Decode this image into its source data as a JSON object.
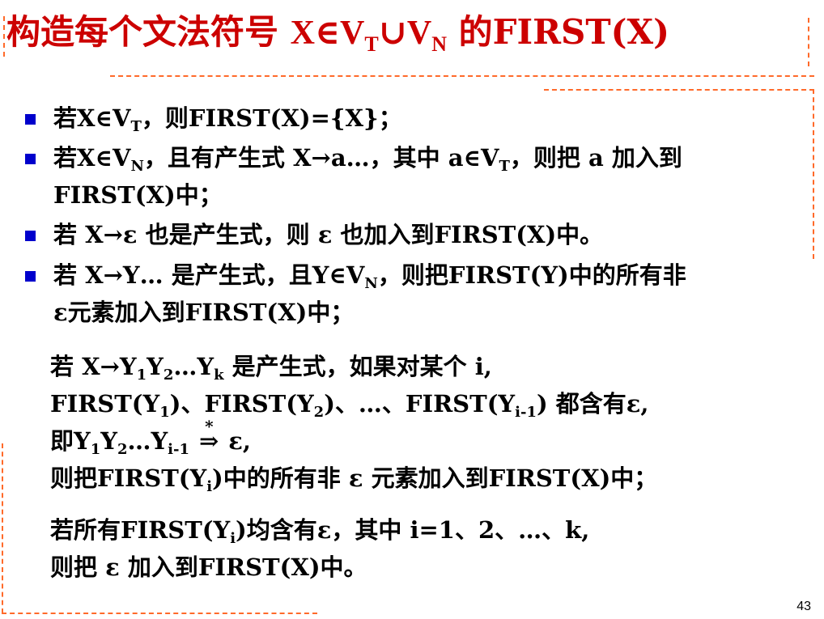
{
  "title": {
    "prefix": "构造每个文法符号 ",
    "formula_a": "X∈V",
    "sub_a": "T",
    "union": "∪V",
    "sub_b": "N",
    "suffix": " 的FIRST(X)"
  },
  "bullets": [
    {
      "lines": [
        [
          {
            "t": "若X∈V"
          },
          {
            "sub": "T"
          },
          {
            "t": "，则FIRST(X)={X}；"
          }
        ]
      ]
    },
    {
      "lines": [
        [
          {
            "t": "若X∈V"
          },
          {
            "sub": "N"
          },
          {
            "t": "，且有产生式 X→a…，其中 a∈V"
          },
          {
            "sub": "T"
          },
          {
            "t": "，则把 a 加入到"
          }
        ],
        [
          {
            "t": "FIRST(X)中；"
          }
        ]
      ]
    },
    {
      "lines": [
        [
          {
            "t": "若 X→ε 也是产生式，则 ε 也加入到FIRST(X)中。"
          }
        ]
      ]
    },
    {
      "lines": [
        [
          {
            "t": "若 X→Y… 是产生式，且Y∈V"
          },
          {
            "sub": "N"
          },
          {
            "t": "，则把FIRST(Y)中的所有非"
          }
        ],
        [
          {
            "t": "ε元素加入到FIRST(X)中；"
          }
        ]
      ]
    }
  ],
  "block1": {
    "row1": [
      {
        "t": "若 X→Y"
      },
      {
        "sub": "1"
      },
      {
        "t": "Y"
      },
      {
        "sub": "2"
      },
      {
        "t": "…Y"
      },
      {
        "sub": "k"
      },
      {
        "t": " 是产生式，如果对某个 i,"
      }
    ],
    "row2": [
      {
        "t": "FIRST(Y"
      },
      {
        "sub": "1"
      },
      {
        "t": ")、FIRST(Y"
      },
      {
        "sub": "2"
      },
      {
        "t": ")、…、FIRST(Y"
      },
      {
        "sub": "i-1"
      },
      {
        "t": ") 都含有ε,"
      }
    ],
    "row3_pre": [
      {
        "t": "即Y"
      },
      {
        "sub": "1"
      },
      {
        "t": "Y"
      },
      {
        "sub": "2"
      },
      {
        "t": "…Y"
      },
      {
        "sub": "i-1"
      }
    ],
    "derive_arrow": "⇒",
    "derive_star": "*",
    "row3_post": " ε,",
    "row4": [
      {
        "t": "则把FIRST(Y"
      },
      {
        "sub": "i"
      },
      {
        "t": ")中的所有非 ε 元素加入到FIRST(X)中；"
      }
    ]
  },
  "block2": {
    "row1": [
      {
        "t": "若所有FIRST(Y"
      },
      {
        "sub": "i"
      },
      {
        "t": ")均含有ε，其中 i=1、2、…、k,"
      }
    ],
    "row2": [
      {
        "t": "则把 ε 加入到FIRST(X)中。"
      }
    ]
  },
  "page_number": "43",
  "colors": {
    "title": "#cc0000",
    "bullet": "#0000cc",
    "dashed_rule": "#ff6a2a"
  }
}
